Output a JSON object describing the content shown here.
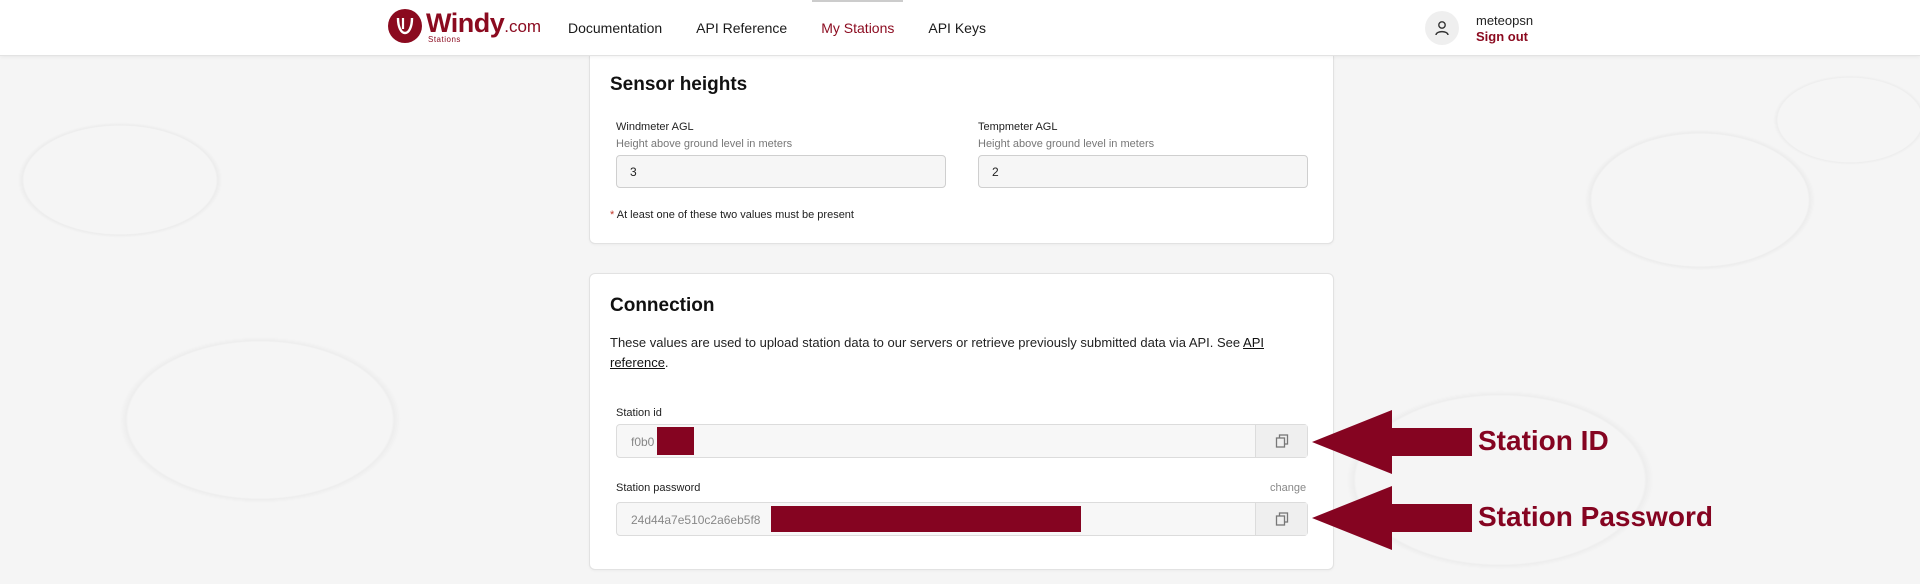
{
  "header": {
    "logo_name": "Windy",
    "logo_tld": ".com",
    "logo_sub": "Stations",
    "nav": [
      {
        "label": "Documentation"
      },
      {
        "label": "API Reference"
      },
      {
        "label": "My Stations",
        "active": true
      },
      {
        "label": "API Keys"
      }
    ],
    "user": {
      "username": "meteopsn",
      "sign_out": "Sign out"
    }
  },
  "sensor_heights": {
    "title": "Sensor heights",
    "windmeter": {
      "label": "Windmeter AGL",
      "hint": "Height above ground level in meters",
      "value": "3"
    },
    "tempmeter": {
      "label": "Tempmeter AGL",
      "hint": "Height above ground level in meters",
      "value": "2"
    },
    "note_star": "*",
    "note": "At least one of these two values must be present"
  },
  "connection": {
    "title": "Connection",
    "description": "These values are used to upload station data to our servers or retrieve previously submitted data via API. See ",
    "link_text": "API reference",
    "period": ".",
    "station_id": {
      "label": "Station id",
      "value": "f0b0"
    },
    "station_password": {
      "label": "Station password",
      "value": "24d44a7e510c2a6eb5f8",
      "change": "change"
    }
  },
  "annotations": {
    "station_id": "Station ID",
    "station_password": "Station Password"
  },
  "colors": {
    "brand": "#8b0a1f",
    "redaction": "#850421"
  }
}
